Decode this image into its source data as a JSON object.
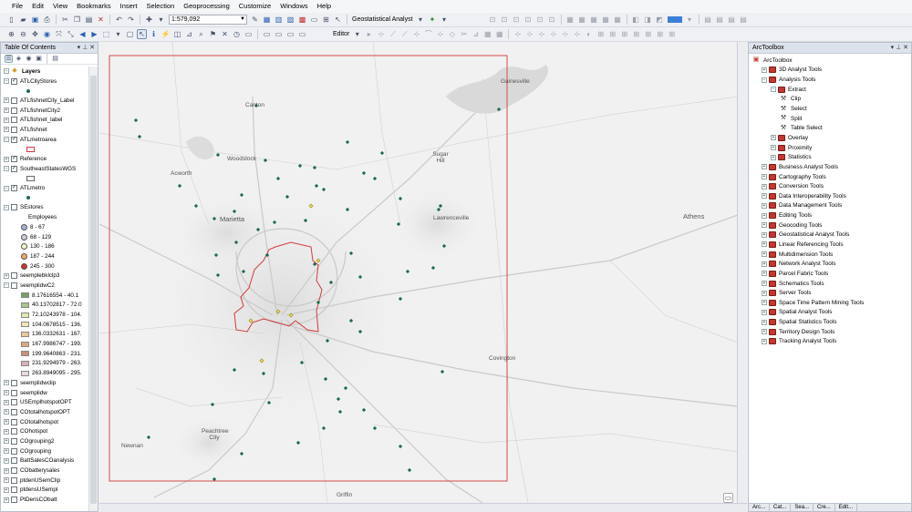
{
  "menu": [
    "File",
    "Edit",
    "View",
    "Bookmarks",
    "Insert",
    "Selection",
    "Geoprocessing",
    "Customize",
    "Windows",
    "Help"
  ],
  "toolbar": {
    "scale": "1:579,092",
    "geostat": "Geostatistical Analyst",
    "editor": "Editor"
  },
  "toc": {
    "title": "Table Of Contents",
    "layers_heading": "Layers",
    "rows": [
      {
        "label": "ATLCityStores",
        "exp": "−",
        "chk": true
      },
      {
        "label": "ATLfishnetCity_Label",
        "exp": "+",
        "chk": false
      },
      {
        "label": "ATLfishnetCity2",
        "exp": "+",
        "chk": false
      },
      {
        "label": "ATLfishnet_label",
        "exp": "+",
        "chk": false
      },
      {
        "label": "ATLfishnet",
        "exp": "+",
        "chk": false
      },
      {
        "label": "ATLmetroarea",
        "exp": "−",
        "chk": true
      },
      {
        "label": "Reference",
        "exp": "+",
        "chk": true
      },
      {
        "label": "SoutheastStatesWGS",
        "exp": "−",
        "chk": true
      },
      {
        "label": "ATLmetro",
        "exp": "−",
        "chk": true
      },
      {
        "label": "SEstores",
        "exp": "−",
        "chk": false
      },
      {
        "label": "Employees",
        "sub": "heading"
      },
      {
        "label": "8 - 67",
        "sub": "dot",
        "color": "#9fb6cf"
      },
      {
        "label": "68 - 129",
        "sub": "dot",
        "color": "#c8d0d8"
      },
      {
        "label": "130 - 186",
        "sub": "dot",
        "color": "#f7f5c9"
      },
      {
        "label": "187 - 244",
        "sub": "dot",
        "color": "#f0a866"
      },
      {
        "label": "245 - 300",
        "sub": "dot",
        "color": "#c9332f"
      },
      {
        "label": "seemplebklclp3",
        "exp": "+",
        "chk": false
      },
      {
        "label": "seemplidwC2",
        "exp": "−",
        "chk": false
      },
      {
        "label": "8.17616554 - 40.1",
        "sub": "swatch",
        "color": "#7aa06a"
      },
      {
        "label": "40.13702817 - 72.0",
        "sub": "swatch",
        "color": "#a9c38a"
      },
      {
        "label": "72.10243978 - 104.",
        "sub": "swatch",
        "color": "#e3e7b2"
      },
      {
        "label": "104.0678515 - 136.",
        "sub": "swatch",
        "color": "#f3e4b3"
      },
      {
        "label": "136.0332631 - 167.",
        "sub": "swatch",
        "color": "#e9c99b"
      },
      {
        "label": "167.9986747 - 199.",
        "sub": "swatch",
        "color": "#d9a883"
      },
      {
        "label": "199.9640863 - 231.",
        "sub": "swatch",
        "color": "#c79178"
      },
      {
        "label": "231.9294979 - 263.",
        "sub": "swatch",
        "color": "#d8b2b8"
      },
      {
        "label": "263.8949095 - 295.",
        "sub": "swatch",
        "color": "#ecd7df"
      },
      {
        "label": "seemplidwclip",
        "exp": "+",
        "chk": false
      },
      {
        "label": "seemplidw",
        "exp": "+",
        "chk": false
      },
      {
        "label": "USEmplhotspotOPT",
        "exp": "+",
        "chk": false
      },
      {
        "label": "COtotalhotspotOPT",
        "exp": "+",
        "chk": false
      },
      {
        "label": "COtotalhotspot",
        "exp": "+",
        "chk": false
      },
      {
        "label": "COhotspot",
        "exp": "+",
        "chk": false
      },
      {
        "label": "COgrouping2",
        "exp": "+",
        "chk": false
      },
      {
        "label": "COgrouping",
        "exp": "+",
        "chk": false
      },
      {
        "label": "BattSalesCOanalysis",
        "exp": "+",
        "chk": false
      },
      {
        "label": "CObatterysales",
        "exp": "+",
        "chk": false
      },
      {
        "label": "ptdenUSemClip",
        "exp": "+",
        "chk": false
      },
      {
        "label": "ptdensUSempl",
        "exp": "+",
        "chk": false
      },
      {
        "label": "PtDensCObatt",
        "exp": "+",
        "chk": false
      }
    ]
  },
  "map": {
    "labels": [
      {
        "text": "Gainesville",
        "cls": "gainesville"
      },
      {
        "text": "Canton",
        "cls": "canton"
      },
      {
        "text": "Woodstock",
        "cls": "woodstock"
      },
      {
        "text": "Acworth",
        "cls": "acworth"
      },
      {
        "text": "Sugar Hill",
        "cls": "sugarhill"
      },
      {
        "text": "Marietta",
        "cls": "marietta"
      },
      {
        "text": "Lawrenceville",
        "cls": "lawrenceville"
      },
      {
        "text": "Athens",
        "cls": "athens"
      },
      {
        "text": "Covington",
        "cls": "covington"
      },
      {
        "text": "Peachtree City",
        "cls": "peachtree"
      },
      {
        "text": "Newnan",
        "cls": "newnan"
      },
      {
        "text": "Griffin",
        "cls": "griffin"
      }
    ],
    "colors": {
      "store_point": "#1d6a52",
      "highlight_point": "#e8d94a",
      "metro_outline": "#d23a3a",
      "boundary": "#d23a3a"
    }
  },
  "toolbox": {
    "title": "ArcToolbox",
    "root": "ArcToolbox",
    "items": [
      {
        "label": "3D Analyst Tools",
        "level": 1,
        "exp": "+",
        "kind": "box"
      },
      {
        "label": "Analysis Tools",
        "level": 1,
        "exp": "−",
        "kind": "box"
      },
      {
        "label": "Extract",
        "level": 2,
        "exp": "−",
        "kind": "box"
      },
      {
        "label": "Clip",
        "level": 3,
        "kind": "tool"
      },
      {
        "label": "Select",
        "level": 3,
        "kind": "tool"
      },
      {
        "label": "Split",
        "level": 3,
        "kind": "tool"
      },
      {
        "label": "Table Select",
        "level": 3,
        "kind": "tool"
      },
      {
        "label": "Overlay",
        "level": 2,
        "exp": "+",
        "kind": "box"
      },
      {
        "label": "Proximity",
        "level": 2,
        "exp": "+",
        "kind": "box"
      },
      {
        "label": "Statistics",
        "level": 2,
        "exp": "+",
        "kind": "box"
      },
      {
        "label": "Business Analyst Tools",
        "level": 1,
        "exp": "+",
        "kind": "box"
      },
      {
        "label": "Cartography Tools",
        "level": 1,
        "exp": "+",
        "kind": "box"
      },
      {
        "label": "Conversion Tools",
        "level": 1,
        "exp": "+",
        "kind": "box"
      },
      {
        "label": "Data Interoperability Tools",
        "level": 1,
        "exp": "+",
        "kind": "box"
      },
      {
        "label": "Data Management Tools",
        "level": 1,
        "exp": "+",
        "kind": "box"
      },
      {
        "label": "Editing Tools",
        "level": 1,
        "exp": "+",
        "kind": "box"
      },
      {
        "label": "Geocoding Tools",
        "level": 1,
        "exp": "+",
        "kind": "box"
      },
      {
        "label": "Geostatistical Analyst Tools",
        "level": 1,
        "exp": "+",
        "kind": "box"
      },
      {
        "label": "Linear Referencing Tools",
        "level": 1,
        "exp": "+",
        "kind": "box"
      },
      {
        "label": "Multidimension Tools",
        "level": 1,
        "exp": "+",
        "kind": "box"
      },
      {
        "label": "Network Analyst Tools",
        "level": 1,
        "exp": "+",
        "kind": "box"
      },
      {
        "label": "Parcel Fabric Tools",
        "level": 1,
        "exp": "+",
        "kind": "box"
      },
      {
        "label": "Schematics Tools",
        "level": 1,
        "exp": "+",
        "kind": "box"
      },
      {
        "label": "Server Tools",
        "level": 1,
        "exp": "+",
        "kind": "box"
      },
      {
        "label": "Space Time Pattern Mining Tools",
        "level": 1,
        "exp": "+",
        "kind": "box"
      },
      {
        "label": "Spatial Analyst Tools",
        "level": 1,
        "exp": "+",
        "kind": "box"
      },
      {
        "label": "Spatial Statistics Tools",
        "level": 1,
        "exp": "+",
        "kind": "box"
      },
      {
        "label": "Territory Design Tools",
        "level": 1,
        "exp": "+",
        "kind": "box"
      },
      {
        "label": "Tracking Analyst Tools",
        "level": 1,
        "exp": "+",
        "kind": "box"
      }
    ],
    "tabs": [
      "Arc...",
      "Cat...",
      "Sea...",
      "Cre...",
      "Edit..."
    ]
  }
}
